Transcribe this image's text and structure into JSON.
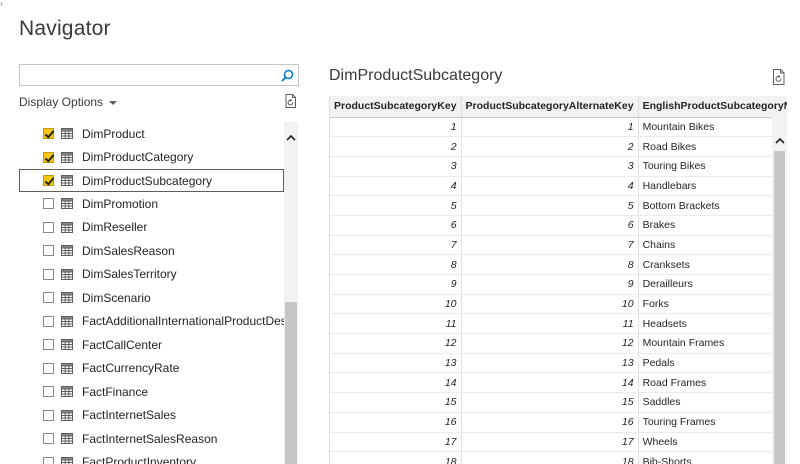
{
  "window": {
    "title": "Navigator"
  },
  "left_pane": {
    "search": {
      "value": "",
      "placeholder": ""
    },
    "display_options_label": "Display Options",
    "items": [
      {
        "label": "DimProduct",
        "checked": true,
        "selected": false
      },
      {
        "label": "DimProductCategory",
        "checked": true,
        "selected": false
      },
      {
        "label": "DimProductSubcategory",
        "checked": true,
        "selected": true
      },
      {
        "label": "DimPromotion",
        "checked": false,
        "selected": false
      },
      {
        "label": "DimReseller",
        "checked": false,
        "selected": false
      },
      {
        "label": "DimSalesReason",
        "checked": false,
        "selected": false
      },
      {
        "label": "DimSalesTerritory",
        "checked": false,
        "selected": false
      },
      {
        "label": "DimScenario",
        "checked": false,
        "selected": false
      },
      {
        "label": "FactAdditionalInternationalProductDes...",
        "checked": false,
        "selected": false
      },
      {
        "label": "FactCallCenter",
        "checked": false,
        "selected": false
      },
      {
        "label": "FactCurrencyRate",
        "checked": false,
        "selected": false
      },
      {
        "label": "FactFinance",
        "checked": false,
        "selected": false
      },
      {
        "label": "FactInternetSales",
        "checked": false,
        "selected": false
      },
      {
        "label": "FactInternetSalesReason",
        "checked": false,
        "selected": false
      },
      {
        "label": "FactProductInventory",
        "checked": false,
        "selected": false
      }
    ]
  },
  "preview": {
    "title": "DimProductSubcategory",
    "columns": [
      "ProductSubcategoryKey",
      "ProductSubcategoryAlternateKey",
      "EnglishProductSubcategoryName"
    ],
    "rows": [
      [
        "1",
        "1",
        "Mountain Bikes"
      ],
      [
        "2",
        "2",
        "Road Bikes"
      ],
      [
        "3",
        "3",
        "Touring Bikes"
      ],
      [
        "4",
        "4",
        "Handlebars"
      ],
      [
        "5",
        "5",
        "Bottom Brackets"
      ],
      [
        "6",
        "6",
        "Brakes"
      ],
      [
        "7",
        "7",
        "Chains"
      ],
      [
        "8",
        "8",
        "Cranksets"
      ],
      [
        "9",
        "9",
        "Derailleurs"
      ],
      [
        "10",
        "10",
        "Forks"
      ],
      [
        "11",
        "11",
        "Headsets"
      ],
      [
        "12",
        "12",
        "Mountain Frames"
      ],
      [
        "13",
        "13",
        "Pedals"
      ],
      [
        "14",
        "14",
        "Road Frames"
      ],
      [
        "15",
        "15",
        "Saddles"
      ],
      [
        "16",
        "16",
        "Touring Frames"
      ],
      [
        "17",
        "17",
        "Wheels"
      ],
      [
        "18",
        "18",
        "Bib-Shorts"
      ]
    ]
  },
  "icons": {
    "search": "search-icon",
    "refresh": "refresh-icon",
    "table": "table-icon",
    "scroll_up": "chevron-up-icon"
  },
  "colors": {
    "check_fill": "#f2c811",
    "accent_text": "#3b3a39",
    "border": "#c8c6c4"
  }
}
